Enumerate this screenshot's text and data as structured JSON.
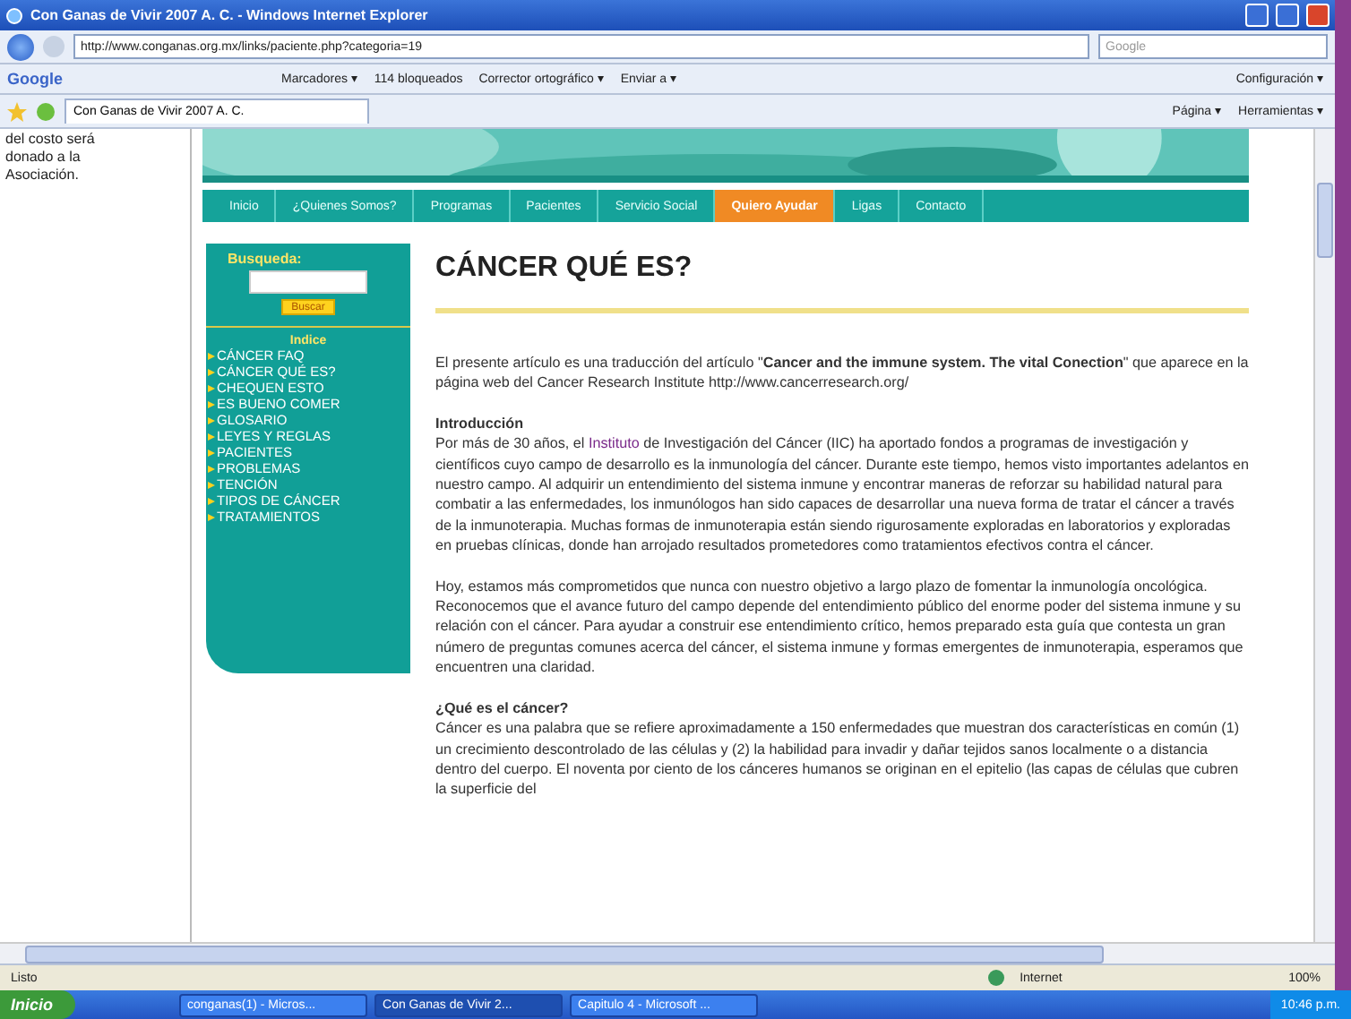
{
  "window": {
    "title": "Con Ganas de Vivir 2007 A. C. - Windows Internet Explorer"
  },
  "address_bar": {
    "url": "http://www.conganas.org.mx/links/paciente.php?categoria=19",
    "search_placeholder": "Google"
  },
  "google_toolbar": {
    "logo": "Google",
    "items": [
      "Marcadores ▾",
      "114 bloqueados",
      "Corrector ortográfico ▾",
      "Enviar a ▾"
    ],
    "settings": "Configuración ▾"
  },
  "tab_bar": {
    "tabs": [
      {
        "label": "Con Ganas de Vivir 2007 A. C.",
        "selected": true
      }
    ],
    "commands": [
      "Página ▾",
      "Herramientas ▾"
    ]
  },
  "left_panel": {
    "text": "del costo será donado a la Asociación."
  },
  "site": {
    "nav": [
      {
        "label": "Inicio",
        "selected": false
      },
      {
        "label": "¿Quienes Somos?",
        "selected": false
      },
      {
        "label": "Programas",
        "selected": false
      },
      {
        "label": "Pacientes",
        "selected": false
      },
      {
        "label": "Servicio Social",
        "selected": false
      },
      {
        "label": "Quiero Ayudar",
        "selected": true
      },
      {
        "label": "Ligas",
        "selected": false
      },
      {
        "label": "Contacto",
        "selected": false
      }
    ],
    "sidebar": {
      "search_label": "Busqueda:",
      "search_button": "Buscar",
      "index_title": "Indice",
      "items": [
        "CÁNCER FAQ",
        "CÁNCER QUÉ ES?",
        "CHEQUEN ESTO",
        "ES BUENO COMER",
        "GLOSARIO",
        "LEYES Y REGLAS",
        "PACIENTES",
        "PROBLEMAS",
        "TENCIÓN",
        "TIPOS DE CÁNCER",
        "TRATAMIENTOS"
      ]
    },
    "article": {
      "title": "CÁNCER QUÉ ES?",
      "blocks": [
        {
          "kind": "paragraph",
          "text": "El presente artículo es una traducción del artículo \"**Cancer and the immune system. The vital Conection**\" que aparece en la página web del Cancer Research Institute http://www.cancerresearch.org/"
        },
        {
          "kind": "section",
          "heading": "Introducción",
          "before": "Por más de 30 años, el ",
          "link": "Instituto",
          "after": " de Investigación del Cáncer (IIC) ha aportado fondos a programas de investigación y científicos cuyo campo de desarrollo es la inmunología del cáncer. Durante este tiempo, hemos visto importantes adelantos en nuestro campo. Al adquirir un entendimiento del sistema inmune y encontrar maneras de reforzar su habilidad natural para combatir a las enfermedades, los inmunólogos han sido capaces de desarrollar una nueva forma de tratar el cáncer a través de la inmunoterapia. Muchas formas de inmunoterapia están siendo rigurosamente exploradas en laboratorios y exploradas en pruebas clínicas, donde han arrojado resultados prometedores como tratamientos efectivos contra el cáncer."
        },
        {
          "kind": "paragraph",
          "text": "Hoy, estamos más comprometidos que nunca con nuestro objetivo a largo plazo de fomentar la inmunología oncológica. Reconocemos que el avance futuro del campo depende del entendimiento público del enorme poder del sistema inmune y su relación con el cáncer. Para ayudar a construir ese entendimiento crítico, hemos preparado esta guía que contesta un gran número de preguntas comunes acerca del cáncer, el sistema inmune y formas emergentes de inmunoterapia, esperamos que encuentren una claridad."
        },
        {
          "kind": "section",
          "heading": "¿Qué es el cáncer?",
          "before": "Cáncer es una palabra que se refiere aproximadamente a 150 enfermedades que muestran dos características en común (1) un crecimiento descontrolado de las células y (2) la habilidad para invadir y dañar tejidos sanos localmente o a distancia dentro del cuerpo. El noventa por ciento de los cánceres humanos se originan en el epitelio (las capas de células que cubren la superficie del"
        }
      ]
    }
  },
  "status_bar": {
    "text": "Listo",
    "zone": "Internet",
    "zoom": "100%"
  },
  "taskbar": {
    "start": "Inicio",
    "tasks": [
      {
        "label": "conganas(1) - Micros...",
        "selected": false
      },
      {
        "label": "Con Ganas de Vivir 2...",
        "selected": true
      },
      {
        "label": "Capitulo 4 - Microsoft ...",
        "selected": false
      }
    ],
    "clock": "10:46 p.m."
  }
}
